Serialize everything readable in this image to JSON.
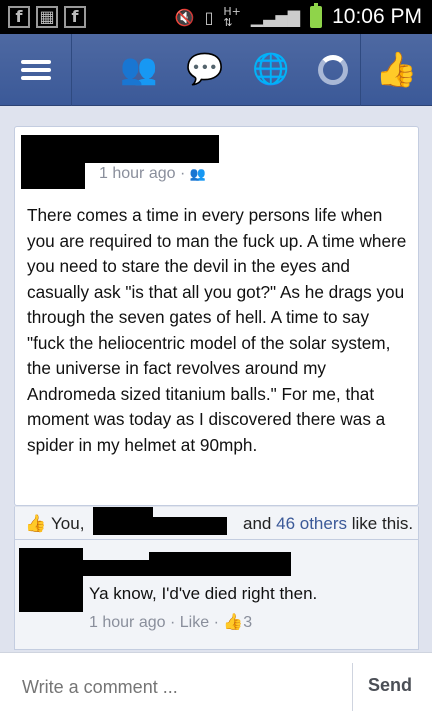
{
  "status_bar": {
    "time": "10:06 PM",
    "left_icons": [
      "facebook-notification-icon",
      "gallery-notification-icon",
      "facebook-notification-icon"
    ],
    "right_icons": [
      "mute-icon",
      "vibrate-icon",
      "data-transfer-icon",
      "signal-icon",
      "battery-icon"
    ],
    "data_label": "H+"
  },
  "nav": {
    "icons": [
      "menu-icon",
      "friend-requests-icon",
      "messages-icon",
      "notifications-icon",
      "like-icon"
    ]
  },
  "story": {
    "timestamp": "1 hour ago",
    "separator": "·",
    "text": "There comes a time in every persons life when you are required to man the fuck up. A time where you need to stare the devil in the eyes and casually ask \"is that all you got?\" As he drags you through the seven gates of hell. A time to say \"fuck the heliocentric model of the solar system, the universe in fact revolves around my Andromeda sized titanium balls.\" For me, that moment was today as I discovered there was a spider in my helmet at 90mph."
  },
  "likes": {
    "you": "You,",
    "and": "and",
    "others": "46 others",
    "suffix": "like this."
  },
  "comment": {
    "text": "Ya know, I'd've died right then.",
    "timestamp": "1 hour ago",
    "like_link": "Like",
    "like_count": "3"
  },
  "composer": {
    "placeholder": "Write a comment ...",
    "send_label": "Send"
  },
  "colors": {
    "facebook_blue": "#3b5998",
    "background": "#dfe3ee"
  }
}
